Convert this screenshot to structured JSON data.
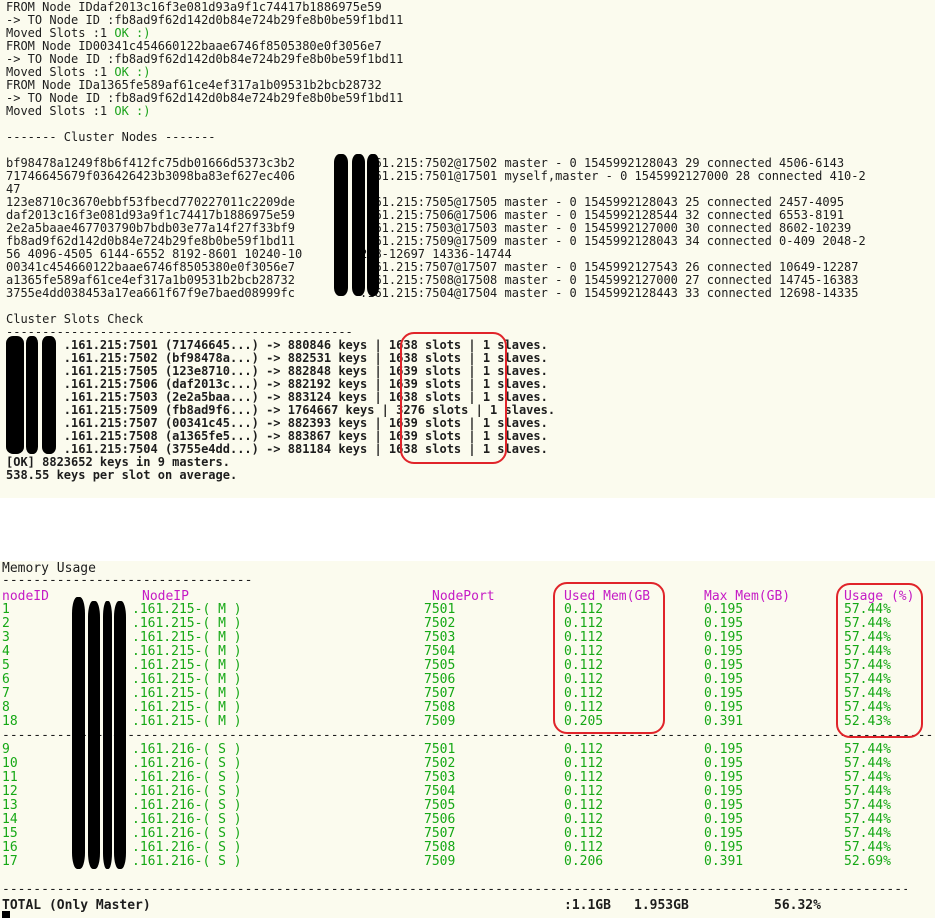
{
  "terminal_top": {
    "lines": [
      {
        "t": "FROM Node IDdaf2013c16f3e081d93a9f1c74417b1886975e59"
      },
      {
        "t": "-> TO Node ID :fb8ad9f62d142d0b84e724b29fe8b0be59f1bd11"
      },
      {
        "t": "Moved Slots :1 ",
        "ok": "OK :)"
      },
      {
        "t": "FROM Node ID00341c454660122baae6746f8505380e0f3056e7"
      },
      {
        "t": "-> TO Node ID :fb8ad9f62d142d0b84e724b29fe8b0be59f1bd11"
      },
      {
        "t": "Moved Slots :1 ",
        "ok": "OK :)"
      },
      {
        "t": "FROM Node IDa1365fe589af61ce4ef317a1b09531b2bcb28732"
      },
      {
        "t": "-> TO Node ID :fb8ad9f62d142d0b84e724b29fe8b0be59f1bd11"
      },
      {
        "t": "Moved Slots :1 ",
        "ok": "OK :)"
      },
      {
        "t": ""
      },
      {
        "t": "------- Cluster Nodes -------"
      },
      {
        "t": ""
      },
      {
        "t": "bf98478a1249f8b6f412fc75db01666d5373c3b2         .161.215:7502@17502 master - 0 1545992128043 29 connected 4506-6143"
      },
      {
        "t": "71746645679f036426423b3098ba83ef627ec406         .161.215:7501@17501 myself,master - 0 1545992127000 28 connected 410-2"
      },
      {
        "t": "47"
      },
      {
        "t": "123e8710c3670ebbf53fbecd770227011c2209de         .161.215:7505@17505 master - 0 1545992128043 25 connected 2457-4095"
      },
      {
        "t": "daf2013c16f3e081d93a9f1c74417b1886975e59         .161.215:7506@17506 master - 0 1545992128544 32 connected 6553-8191"
      },
      {
        "t": "2e2a5baae467703790b7bdb03e77a14f27f33bf9         .161.215:7503@17503 master - 0 1545992127000 30 connected 8602-10239"
      },
      {
        "t": "fb8ad9f62d142d0b84e724b29fe8b0be59f1bd11         .161.215:7509@17509 master - 0 1545992128043 34 connected 0-409 2048-2"
      },
      {
        "t": "56 4096-4505 6144-6552 8192-8601 10240-10        288-12697 14336-14744"
      },
      {
        "t": "00341c454660122baae6746f8505380e0f3056e7         .161.215:7507@17507 master - 0 1545992127543 26 connected 10649-12287"
      },
      {
        "t": "a1365fe589af61ce4ef317a1b09531b2bcb28732         .161.215:7508@17508 master - 0 1545992127000 27 connected 14745-16383"
      },
      {
        "t": "3755e4dd038453a17ea661f67f9e7baed08999fc         .161.215:7504@17504 master - 0 1545992128443 33 connected 12698-14335"
      },
      {
        "t": ""
      },
      {
        "t": "Cluster Slots Check"
      },
      {
        "t": "------------------------------------------------"
      },
      {
        "t": "        .161.215:7501 (71746645...) -> 880846 keys | 1638 slots | 1 slaves.",
        "b": true
      },
      {
        "t": "        .161.215:7502 (bf98478a...) -> 882531 keys | 1638 slots | 1 slaves.",
        "b": true
      },
      {
        "t": "        .161.215:7505 (123e8710...) -> 882848 keys | 1639 slots | 1 slaves.",
        "b": true
      },
      {
        "t": "        .161.215:7506 (daf2013c...) -> 882192 keys | 1639 slots | 1 slaves.",
        "b": true
      },
      {
        "t": "        .161.215:7503 (2e2a5baa...) -> 883124 keys | 1638 slots | 1 slaves.",
        "b": true
      },
      {
        "t": "        .161.215:7509 (fb8ad9f6...) -> 1764667 keys | 3276 slots | 1 slaves.",
        "b": true
      },
      {
        "t": "        .161.215:7507 (00341c45...) -> 882393 keys | 1639 slots | 1 slaves.",
        "b": true
      },
      {
        "t": "        .161.215:7508 (a1365fe5...) -> 883867 keys | 1639 slots | 1 slaves.",
        "b": true
      },
      {
        "t": "        .161.215:7504 (3755e4dd...) -> 881184 keys | 1638 slots | 1 slaves.",
        "b": true
      },
      {
        "t": "[OK] 8823652 keys in 9 masters.",
        "b": true
      },
      {
        "t": "538.55 keys per slot on average.",
        "b": true
      }
    ]
  },
  "memory": {
    "title": "Memory Usage",
    "title_rule": "--------------------------------",
    "headers": {
      "node_id": "nodeID",
      "node_ip": "NodeIP",
      "node_port": "NodePort",
      "used_mem": "Used Mem(GB",
      "max_mem": "Max Mem(GB)",
      "usage": "Usage (%)"
    },
    "masters": [
      {
        "id": "1",
        "ip": ".161.215-( M )",
        "port": "7501",
        "used": "0.112",
        "max": "0.195",
        "usage": "57.44%"
      },
      {
        "id": "2",
        "ip": ".161.215-( M )",
        "port": "7502",
        "used": "0.112",
        "max": "0.195",
        "usage": "57.44%"
      },
      {
        "id": "3",
        "ip": ".161.215-( M )",
        "port": "7503",
        "used": "0.112",
        "max": "0.195",
        "usage": "57.44%"
      },
      {
        "id": "4",
        "ip": ".161.215-( M )",
        "port": "7504",
        "used": "0.112",
        "max": "0.195",
        "usage": "57.44%"
      },
      {
        "id": "5",
        "ip": ".161.215-( M )",
        "port": "7505",
        "used": "0.112",
        "max": "0.195",
        "usage": "57.44%"
      },
      {
        "id": "6",
        "ip": ".161.215-( M )",
        "port": "7506",
        "used": "0.112",
        "max": "0.195",
        "usage": "57.44%"
      },
      {
        "id": "7",
        "ip": ".161.215-( M )",
        "port": "7507",
        "used": "0.112",
        "max": "0.195",
        "usage": "57.44%"
      },
      {
        "id": "8",
        "ip": ".161.215-( M )",
        "port": "7508",
        "used": "0.112",
        "max": "0.195",
        "usage": "57.44%"
      },
      {
        "id": "18",
        "ip": ".161.215-( M )",
        "port": "7509",
        "used": "0.205",
        "max": "0.391",
        "usage": "52.43%"
      }
    ],
    "slaves": [
      {
        "id": "9",
        "ip": ".161.216-( S )",
        "port": "7501",
        "used": "0.112",
        "max": "0.195",
        "usage": "57.44%"
      },
      {
        "id": "10",
        "ip": ".161.216-( S )",
        "port": "7502",
        "used": "0.112",
        "max": "0.195",
        "usage": "57.44%"
      },
      {
        "id": "11",
        "ip": ".161.216-( S )",
        "port": "7503",
        "used": "0.112",
        "max": "0.195",
        "usage": "57.44%"
      },
      {
        "id": "12",
        "ip": ".161.216-( S )",
        "port": "7504",
        "used": "0.112",
        "max": "0.195",
        "usage": "57.44%"
      },
      {
        "id": "13",
        "ip": ".161.216-( S )",
        "port": "7505",
        "used": "0.112",
        "max": "0.195",
        "usage": "57.44%"
      },
      {
        "id": "14",
        "ip": ".161.216-( S )",
        "port": "7506",
        "used": "0.112",
        "max": "0.195",
        "usage": "57.44%"
      },
      {
        "id": "15",
        "ip": ".161.216-( S )",
        "port": "7507",
        "used": "0.112",
        "max": "0.195",
        "usage": "57.44%"
      },
      {
        "id": "16",
        "ip": ".161.216-( S )",
        "port": "7508",
        "used": "0.112",
        "max": "0.195",
        "usage": "57.44%"
      },
      {
        "id": "17",
        "ip": ".161.216-( S )",
        "port": "7509",
        "used": "0.206",
        "max": "0.391",
        "usage": "52.69%"
      }
    ],
    "separator": "-----------------------------------------------------------------------------------------------------------------------------------",
    "total": {
      "label": "TOTAL (Only Master)",
      "used": ":1.1GB",
      "max": "1.953GB",
      "usage": "56.32%"
    }
  },
  "colors": {
    "annotation_red": "#e0242a",
    "value_green": "#15a815",
    "header_magenta": "#c51bc5",
    "background": "#fbfbee"
  }
}
